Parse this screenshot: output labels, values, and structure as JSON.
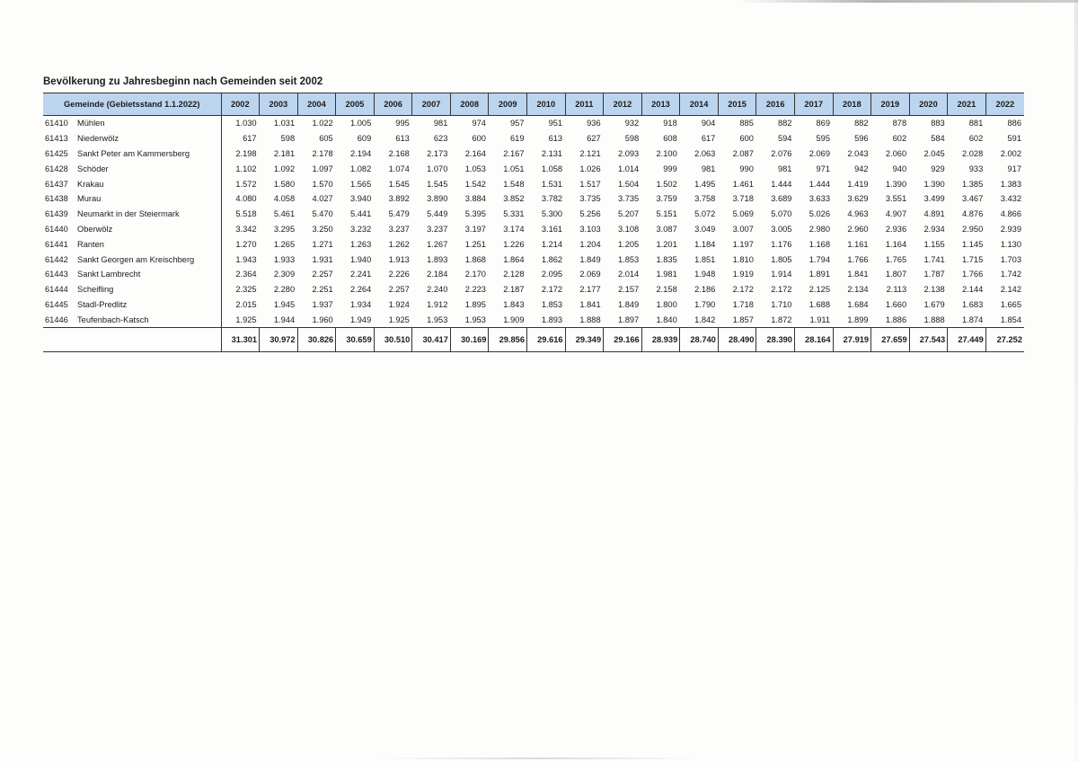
{
  "title": "Bevölkerung zu Jahresbeginn nach Gemeinden seit 2002",
  "header_name": "Gemeinde (Gebietsstand 1.1.2022)",
  "years": [
    "2002",
    "2003",
    "2004",
    "2005",
    "2006",
    "2007",
    "2008",
    "2009",
    "2010",
    "2011",
    "2012",
    "2013",
    "2014",
    "2015",
    "2016",
    "2017",
    "2018",
    "2019",
    "2020",
    "2021",
    "2022"
  ],
  "rows": [
    {
      "code": "61410",
      "name": "Mühlen",
      "values": [
        "1.030",
        "1.031",
        "1.022",
        "1.005",
        "995",
        "981",
        "974",
        "957",
        "951",
        "936",
        "932",
        "918",
        "904",
        "885",
        "882",
        "869",
        "882",
        "878",
        "883",
        "881",
        "886"
      ]
    },
    {
      "code": "61413",
      "name": "Niederwölz",
      "values": [
        "617",
        "598",
        "605",
        "609",
        "613",
        "623",
        "600",
        "619",
        "613",
        "627",
        "598",
        "608",
        "617",
        "600",
        "594",
        "595",
        "596",
        "602",
        "584",
        "602",
        "591"
      ]
    },
    {
      "code": "61425",
      "name": "Sankt Peter am Kammersberg",
      "values": [
        "2.198",
        "2.181",
        "2.178",
        "2.194",
        "2.168",
        "2.173",
        "2.164",
        "2.167",
        "2.131",
        "2.121",
        "2.093",
        "2.100",
        "2.063",
        "2.087",
        "2.076",
        "2.069",
        "2.043",
        "2.060",
        "2.045",
        "2.028",
        "2.002"
      ]
    },
    {
      "code": "61428",
      "name": "Schöder",
      "values": [
        "1.102",
        "1.092",
        "1.097",
        "1.082",
        "1.074",
        "1.070",
        "1.053",
        "1.051",
        "1.058",
        "1.026",
        "1.014",
        "999",
        "981",
        "990",
        "981",
        "971",
        "942",
        "940",
        "929",
        "933",
        "917"
      ]
    },
    {
      "code": "61437",
      "name": "Krakau",
      "values": [
        "1.572",
        "1.580",
        "1.570",
        "1.565",
        "1.545",
        "1.545",
        "1.542",
        "1.548",
        "1.531",
        "1.517",
        "1.504",
        "1.502",
        "1.495",
        "1.461",
        "1.444",
        "1.444",
        "1.419",
        "1.390",
        "1.390",
        "1.385",
        "1.383"
      ]
    },
    {
      "code": "61438",
      "name": "Murau",
      "values": [
        "4.080",
        "4.058",
        "4.027",
        "3.940",
        "3.892",
        "3.890",
        "3.884",
        "3.852",
        "3.782",
        "3.735",
        "3.735",
        "3.759",
        "3.758",
        "3.718",
        "3.689",
        "3.633",
        "3.629",
        "3.551",
        "3.499",
        "3.467",
        "3.432"
      ]
    },
    {
      "code": "61439",
      "name": "Neumarkt in der Steiermark",
      "values": [
        "5.518",
        "5.461",
        "5.470",
        "5.441",
        "5.479",
        "5.449",
        "5.395",
        "5.331",
        "5.300",
        "5.256",
        "5.207",
        "5.151",
        "5.072",
        "5.069",
        "5.070",
        "5.026",
        "4.963",
        "4.907",
        "4.891",
        "4.876",
        "4.866"
      ]
    },
    {
      "code": "61440",
      "name": "Oberwölz",
      "values": [
        "3.342",
        "3.295",
        "3.250",
        "3.232",
        "3.237",
        "3.237",
        "3.197",
        "3.174",
        "3.161",
        "3.103",
        "3.108",
        "3.087",
        "3.049",
        "3.007",
        "3.005",
        "2.980",
        "2.960",
        "2.936",
        "2.934",
        "2.950",
        "2.939"
      ]
    },
    {
      "code": "61441",
      "name": "Ranten",
      "values": [
        "1.270",
        "1.265",
        "1.271",
        "1.263",
        "1.262",
        "1.267",
        "1.251",
        "1.226",
        "1.214",
        "1.204",
        "1.205",
        "1.201",
        "1.184",
        "1.197",
        "1.176",
        "1.168",
        "1.161",
        "1.164",
        "1.155",
        "1.145",
        "1.130"
      ]
    },
    {
      "code": "61442",
      "name": "Sankt Georgen am Kreischberg",
      "values": [
        "1.943",
        "1.933",
        "1.931",
        "1.940",
        "1.913",
        "1.893",
        "1.868",
        "1.864",
        "1.862",
        "1.849",
        "1.853",
        "1.835",
        "1.851",
        "1.810",
        "1.805",
        "1.794",
        "1.766",
        "1.765",
        "1.741",
        "1.715",
        "1.703"
      ]
    },
    {
      "code": "61443",
      "name": "Sankt Lambrecht",
      "values": [
        "2.364",
        "2.309",
        "2.257",
        "2.241",
        "2.226",
        "2.184",
        "2.170",
        "2.128",
        "2.095",
        "2.069",
        "2.014",
        "1.981",
        "1.948",
        "1.919",
        "1.914",
        "1.891",
        "1.841",
        "1.807",
        "1.787",
        "1.766",
        "1.742"
      ]
    },
    {
      "code": "61444",
      "name": "Scheifling",
      "values": [
        "2.325",
        "2.280",
        "2.251",
        "2.264",
        "2.257",
        "2.240",
        "2.223",
        "2.187",
        "2.172",
        "2.177",
        "2.157",
        "2.158",
        "2.186",
        "2.172",
        "2.172",
        "2.125",
        "2.134",
        "2.113",
        "2.138",
        "2.144",
        "2.142"
      ]
    },
    {
      "code": "61445",
      "name": "Stadl-Predlitz",
      "values": [
        "2.015",
        "1.945",
        "1.937",
        "1.934",
        "1.924",
        "1.912",
        "1.895",
        "1.843",
        "1.853",
        "1.841",
        "1.849",
        "1.800",
        "1.790",
        "1.718",
        "1.710",
        "1.688",
        "1.684",
        "1.660",
        "1.679",
        "1.683",
        "1.665"
      ]
    },
    {
      "code": "61446",
      "name": "Teufenbach-Katsch",
      "values": [
        "1.925",
        "1.944",
        "1.960",
        "1.949",
        "1.925",
        "1.953",
        "1.953",
        "1.909",
        "1.893",
        "1.888",
        "1.897",
        "1.840",
        "1.842",
        "1.857",
        "1.872",
        "1.911",
        "1.899",
        "1.886",
        "1.888",
        "1.874",
        "1.854"
      ]
    }
  ],
  "totals": [
    "31.301",
    "30.972",
    "30.826",
    "30.659",
    "30.510",
    "30.417",
    "30.169",
    "29.856",
    "29.616",
    "29.349",
    "29.166",
    "28.939",
    "28.740",
    "28.490",
    "28.390",
    "28.164",
    "27.919",
    "27.659",
    "27.543",
    "27.449",
    "27.252"
  ],
  "colors": {
    "header_fill": "#bcd5ef",
    "rule": "#333333"
  }
}
